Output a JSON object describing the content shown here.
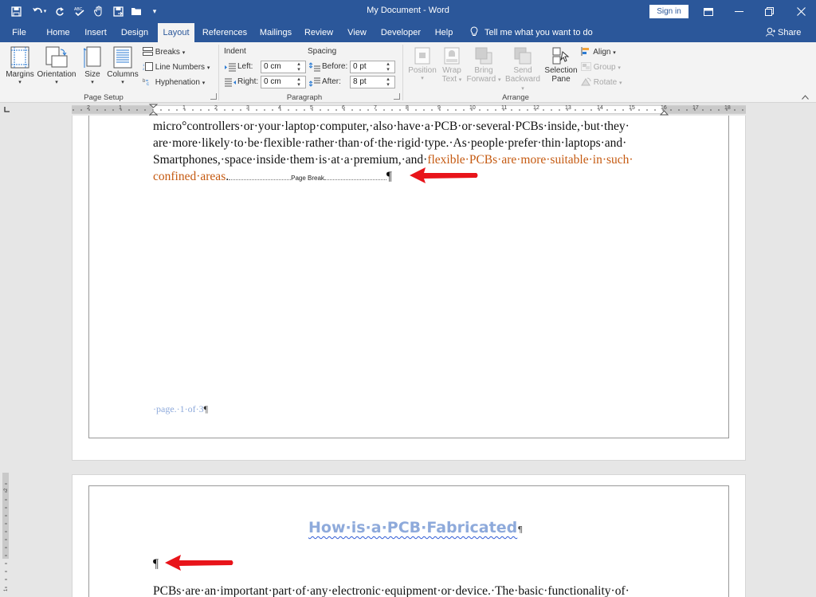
{
  "window": {
    "title": "My Document - Word",
    "sign_in": "Sign in"
  },
  "tabs": [
    {
      "label": "File",
      "active": false
    },
    {
      "label": "Home",
      "active": false
    },
    {
      "label": "Insert",
      "active": false
    },
    {
      "label": "Design",
      "active": false
    },
    {
      "label": "Layout",
      "active": true
    },
    {
      "label": "References",
      "active": false
    },
    {
      "label": "Mailings",
      "active": false
    },
    {
      "label": "Review",
      "active": false
    },
    {
      "label": "View",
      "active": false
    },
    {
      "label": "Developer",
      "active": false
    },
    {
      "label": "Help",
      "active": false
    }
  ],
  "tell_me": "Tell me what you want to do",
  "share": "Share",
  "ribbon": {
    "page_setup": {
      "label": "Page Setup",
      "margins": "Margins",
      "orientation": "Orientation",
      "size": "Size",
      "columns": "Columns",
      "breaks": "Breaks",
      "line_numbers": "Line Numbers",
      "hyphenation": "Hyphenation"
    },
    "paragraph": {
      "label": "Paragraph",
      "indent": "Indent",
      "spacing": "Spacing",
      "left_label": "Left:",
      "left_value": "0 cm",
      "right_label": "Right:",
      "right_value": "0 cm",
      "before_label": "Before:",
      "before_value": "0 pt",
      "after_label": "After:",
      "after_value": "8 pt"
    },
    "arrange": {
      "label": "Arrange",
      "position": "Position",
      "wrap_text_1": "Wrap",
      "wrap_text_2": "Text",
      "bring_forward_1": "Bring",
      "bring_forward_2": "Forward",
      "send_backward_1": "Send",
      "send_backward_2": "Backward",
      "selection_pane_1": "Selection",
      "selection_pane_2": "Pane",
      "align": "Align",
      "group": "Group",
      "rotate": "Rotate"
    }
  },
  "ruler": {
    "numbers": [
      "2",
      "1",
      "1",
      "2",
      "3",
      "4",
      "5",
      "6",
      "7",
      "8",
      "9",
      "10",
      "11",
      "12",
      "13",
      "14",
      "15",
      "16",
      "17",
      "18"
    ]
  },
  "document": {
    "page1_lines": [
      "micro°controllers·or·your·laptop·computer,·also·have·a·PCB·or·several·PCBs·inside,·but·they·",
      "are·more·likely·to·be·flexible·rather·than·of·the·rigid·type.·As·people·prefer·thin·laptops·and·",
      "Smartphones,·space·inside·them·is·at·a·premium,·and·"
    ],
    "page1_orange_1": "flexible·PCBs·are·more·suitable·in·such·",
    "page1_orange_2": "confined·areas",
    "page1_period": ".",
    "page_break": "Page Break",
    "pilcrow": "¶",
    "page_footer": "·page.·1·of·3",
    "heading": "How·is·a·PCB·Fabricated",
    "page2_line": "PCBs·are·an·important·part·of·any·electronic·equipment·or·device.·The·basic·functionality·of·"
  },
  "colors": {
    "accent": "#2b579a",
    "heading": "#8eaadb",
    "orange_text": "#c55a11",
    "arrow": "#e8141a"
  }
}
